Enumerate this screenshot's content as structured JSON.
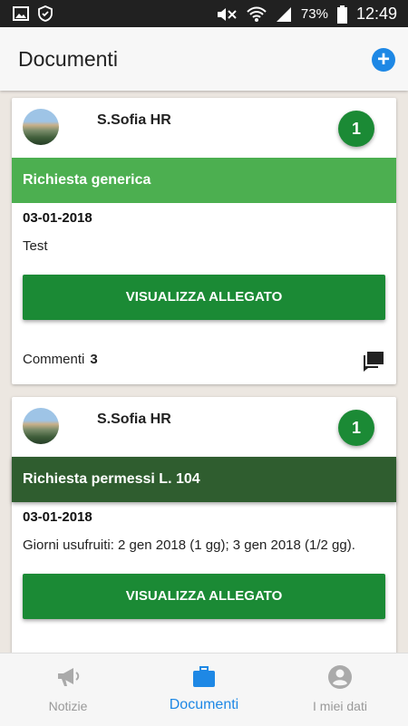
{
  "status_bar": {
    "icons_left": [
      "gallery-icon",
      "shield-icon"
    ],
    "icons_right": [
      "mute-icon",
      "wifi-icon",
      "signal-icon",
      "battery-icon"
    ],
    "battery": "73%",
    "time": "12:49"
  },
  "app_bar": {
    "title": "Documenti",
    "add_icon": "plus-circle-icon",
    "accent": "#1e88e5"
  },
  "documents": [
    {
      "sender": "S.Sofia HR",
      "badge": "1",
      "type": "Richiesta generica",
      "date": "03-01-2018",
      "text": "Test",
      "button": "VISUALIZZA ALLEGATO",
      "comments_label": "Commenti",
      "comments_count": "3"
    },
    {
      "sender": "S.Sofia HR",
      "badge": "1",
      "type": "Richiesta permessi L. 104",
      "date": "03-01-2018",
      "text": "Giorni usufruiti: 2 gen 2018 (1 gg); 3 gen 2018 (1/2 gg).",
      "button": "VISUALIZZA ALLEGATO"
    }
  ],
  "colors": {
    "green_dark": "#1b8a35",
    "green_light": "#4caf50",
    "green_band_dark": "#2f5d2f"
  },
  "bottom_nav": {
    "items": [
      {
        "label": "Notizie",
        "icon": "megaphone-icon",
        "active": false
      },
      {
        "label": "Documenti",
        "icon": "briefcase-icon",
        "active": true
      },
      {
        "label": "I miei dati",
        "icon": "account-circle-icon",
        "active": false
      }
    ]
  }
}
